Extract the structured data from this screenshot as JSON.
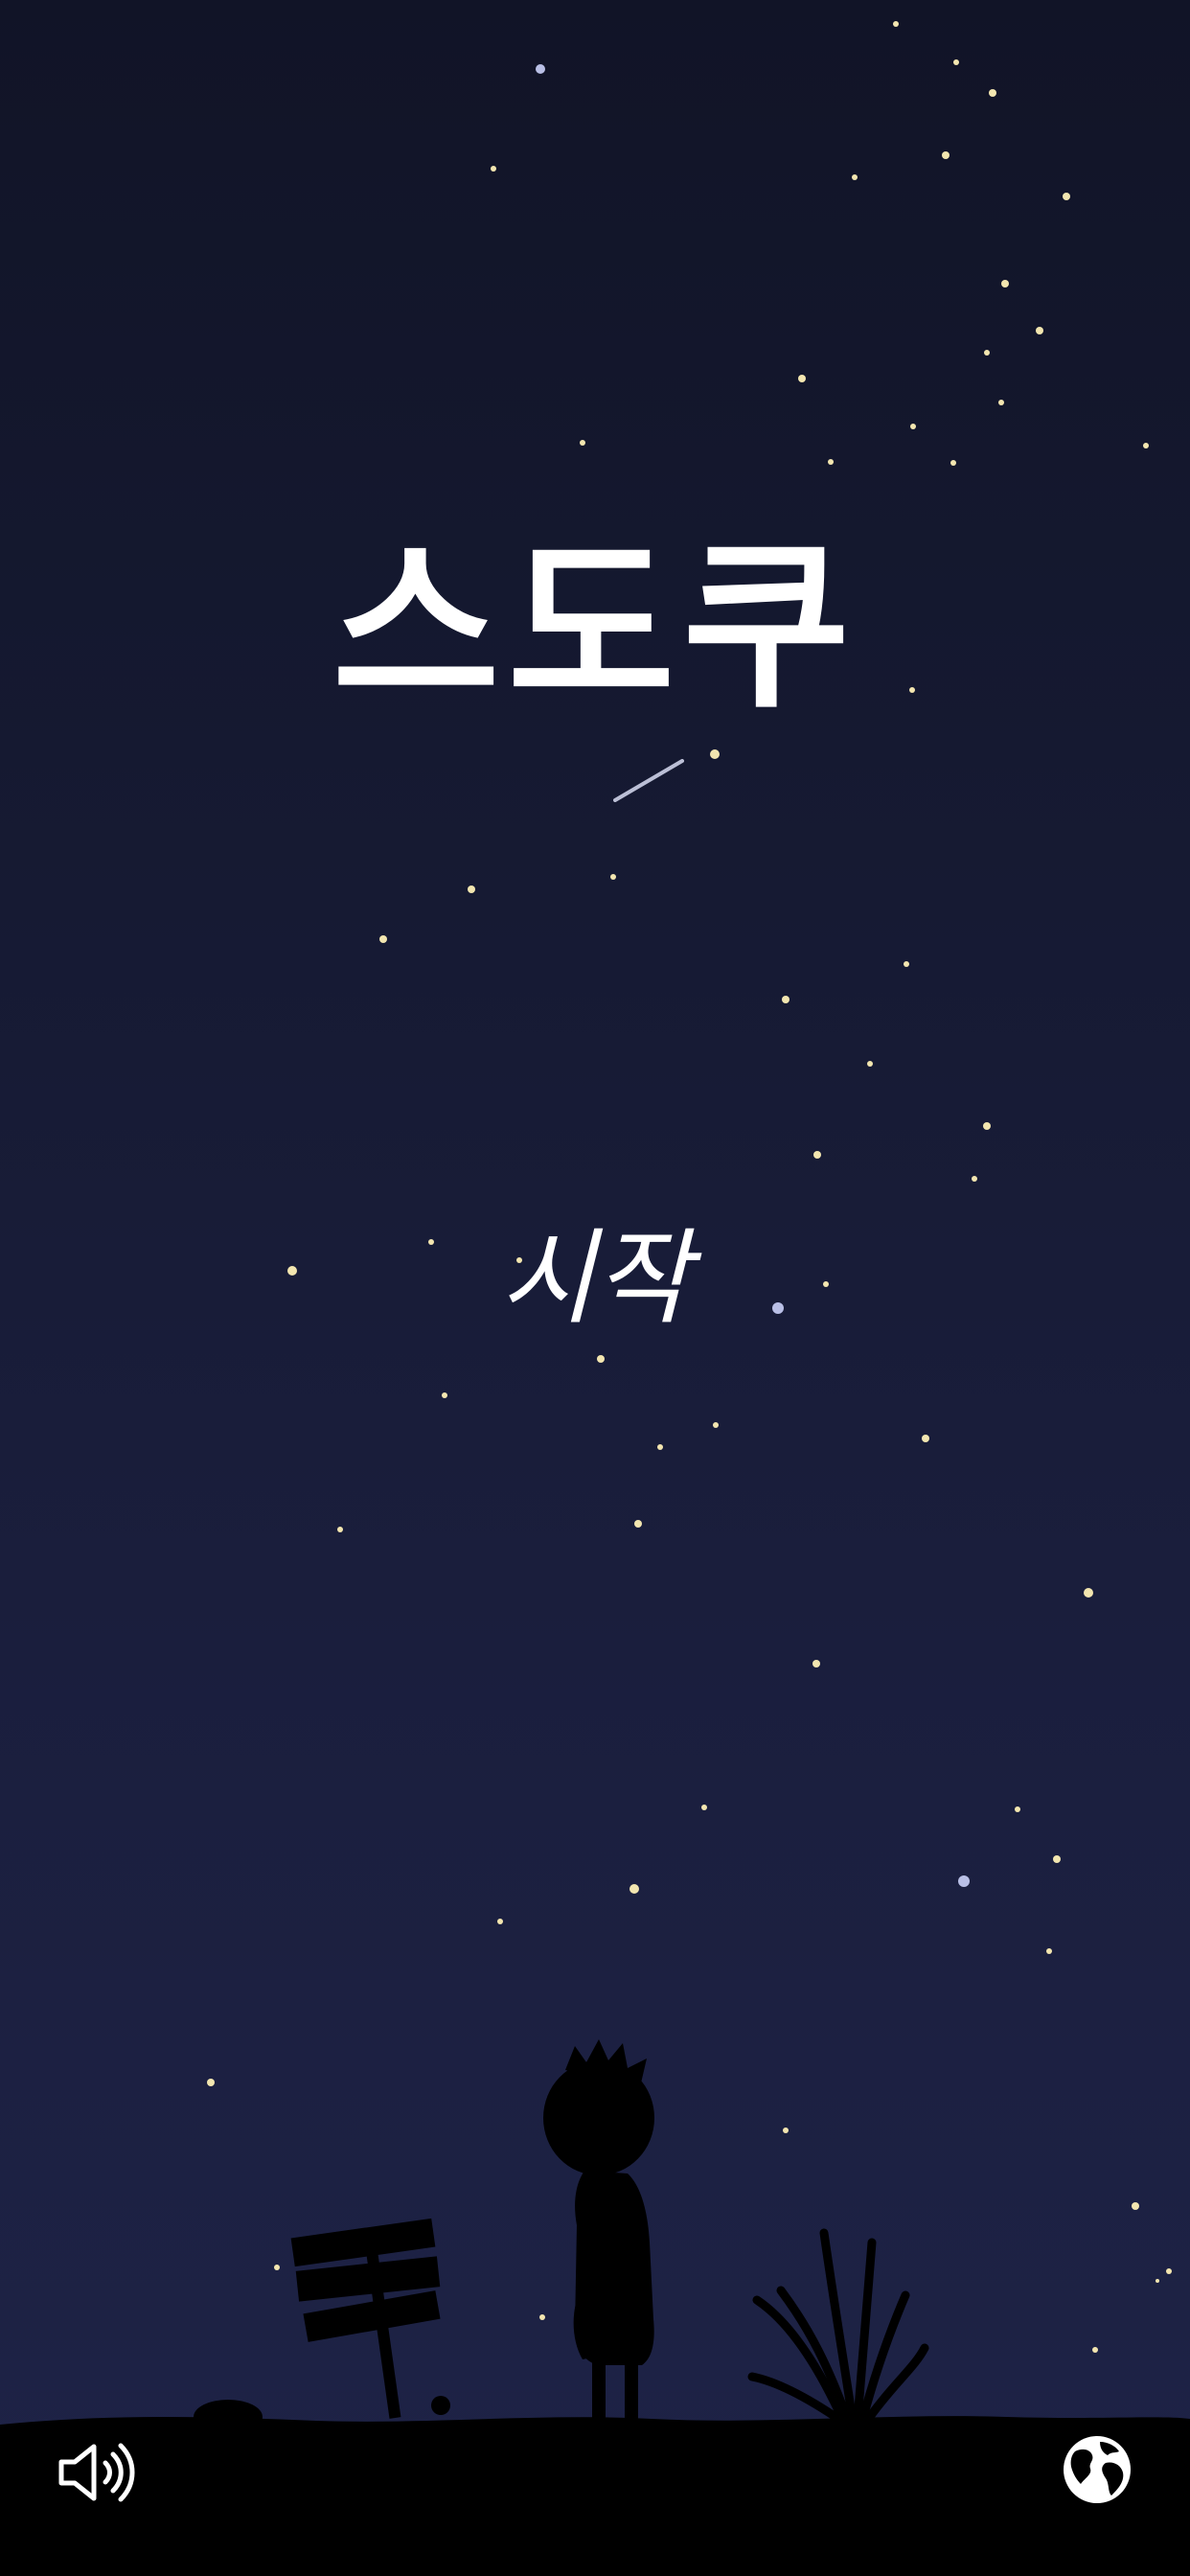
{
  "game": {
    "title": "스도쿠",
    "start_label": "시작"
  },
  "controls": {
    "sound_icon": "speaker-volume-icon",
    "language_icon": "globe-icon"
  },
  "colors": {
    "sky_top": "#111427",
    "sky_bottom": "#1e2347",
    "text": "#ffffff",
    "silhouette": "#000000"
  }
}
